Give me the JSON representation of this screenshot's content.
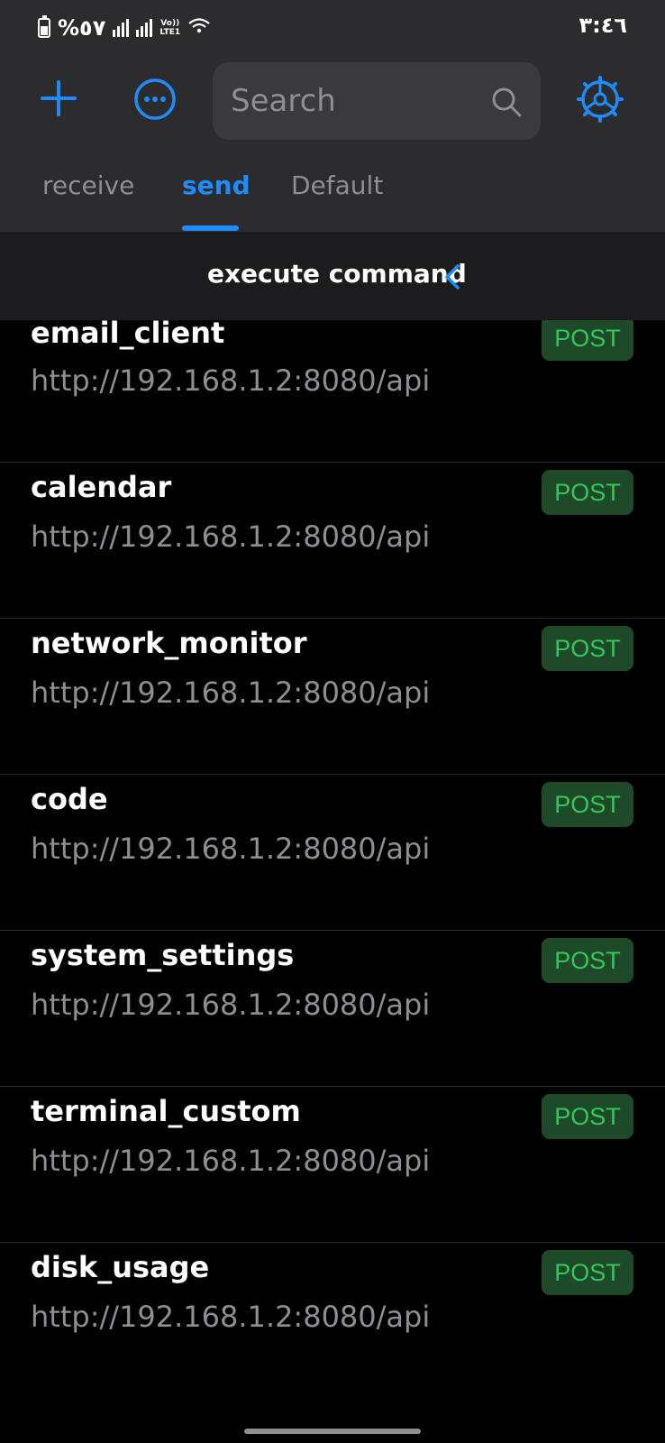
{
  "status_bar": {
    "battery_text": "%٥٧",
    "volte_top": "Vo))",
    "volte_bottom": "LTE1",
    "time": "٣:٤٦"
  },
  "header": {
    "icons": {
      "add": "plus-icon",
      "more": "more-icon",
      "settings": "settings-icon",
      "search": "search-icon"
    },
    "search_placeholder": "Search",
    "accent_color": "#1e8bff",
    "tabs": [
      {
        "label": "receive",
        "active": false
      },
      {
        "label": "send",
        "active": true
      },
      {
        "label": "Default",
        "active": false
      }
    ]
  },
  "subheader": {
    "title": "execute command"
  },
  "list": {
    "items": [
      {
        "name": "email_client",
        "url": "http://192.168.1.2:8080/api",
        "method": "POST"
      },
      {
        "name": "calendar",
        "url": "http://192.168.1.2:8080/api",
        "method": "POST"
      },
      {
        "name": "network_monitor",
        "url": "http://192.168.1.2:8080/api",
        "method": "POST"
      },
      {
        "name": "code",
        "url": "http://192.168.1.2:8080/api",
        "method": "POST"
      },
      {
        "name": "system_settings",
        "url": "http://192.168.1.2:8080/api",
        "method": "POST"
      },
      {
        "name": "terminal_custom",
        "url": "http://192.168.1.2:8080/api",
        "method": "POST"
      },
      {
        "name": "disk_usage",
        "url": "http://192.168.1.2:8080/api",
        "method": "POST"
      }
    ]
  }
}
